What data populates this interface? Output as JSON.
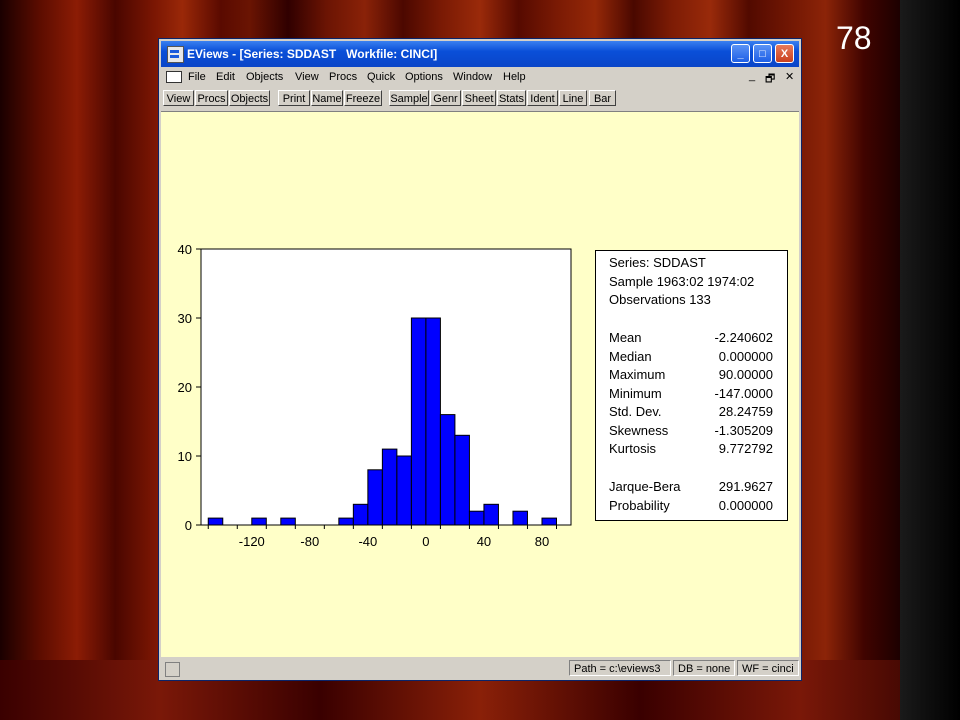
{
  "slide_number": "78",
  "window": {
    "title": "EViews - [Series: SDDAST   Workfile: CINCI]",
    "controls": {
      "minimize": "_",
      "maximize": "□",
      "close": "X"
    }
  },
  "menu": {
    "items": [
      "File",
      "Edit",
      "Objects",
      "View",
      "Procs",
      "Quick",
      "Options",
      "Window",
      "Help"
    ],
    "mdi_controls": [
      "_",
      "🗗",
      "✕"
    ]
  },
  "toolbar": {
    "buttons": [
      "View",
      "Procs",
      "Objects",
      "Print",
      "Name",
      "Freeze",
      "Sample",
      "Genr",
      "Sheet",
      "Stats",
      "Ident",
      "Line",
      "Bar"
    ]
  },
  "chart_data": {
    "type": "bar",
    "title": "",
    "xlabel": "",
    "ylabel": "",
    "bin_width": 10,
    "bins": [
      {
        "x": -145,
        "count": 1
      },
      {
        "x": -135,
        "count": 0
      },
      {
        "x": -125,
        "count": 0
      },
      {
        "x": -115,
        "count": 1
      },
      {
        "x": -105,
        "count": 0
      },
      {
        "x": -95,
        "count": 1
      },
      {
        "x": -85,
        "count": 0
      },
      {
        "x": -75,
        "count": 0
      },
      {
        "x": -65,
        "count": 0
      },
      {
        "x": -55,
        "count": 1
      },
      {
        "x": -45,
        "count": 3
      },
      {
        "x": -35,
        "count": 8
      },
      {
        "x": -25,
        "count": 11
      },
      {
        "x": -15,
        "count": 10
      },
      {
        "x": -5,
        "count": 30
      },
      {
        "x": 5,
        "count": 30
      },
      {
        "x": 15,
        "count": 16
      },
      {
        "x": 25,
        "count": 13
      },
      {
        "x": 35,
        "count": 2
      },
      {
        "x": 45,
        "count": 3
      },
      {
        "x": 55,
        "count": 0
      },
      {
        "x": 65,
        "count": 2
      },
      {
        "x": 75,
        "count": 0
      },
      {
        "x": 85,
        "count": 1
      }
    ],
    "xlim": [
      -155,
      100
    ],
    "ylim": [
      0,
      40
    ],
    "x_ticks": [
      "-120",
      "-80",
      "-40",
      "0",
      "40",
      "80"
    ],
    "y_ticks": [
      "0",
      "10",
      "20",
      "30",
      "40"
    ],
    "bar_color": "#0000ff",
    "grid": false
  },
  "stats": {
    "series_line": "Series: SDDAST",
    "sample_line": "Sample 1963:02 1974:02",
    "obs_line": "Observations 133",
    "rows": [
      {
        "label": "Mean",
        "value": "-2.240602"
      },
      {
        "label": "Median",
        "value": "0.000000"
      },
      {
        "label": "Maximum",
        "value": "90.00000"
      },
      {
        "label": "Minimum",
        "value": "-147.0000"
      },
      {
        "label": "Std. Dev.",
        "value": "28.24759"
      },
      {
        "label": "Skewness",
        "value": "-1.305209"
      },
      {
        "label": "Kurtosis",
        "value": "9.772792"
      }
    ],
    "jb_rows": [
      {
        "label": "Jarque-Bera",
        "value": "291.9627"
      },
      {
        "label": "Probability",
        "value": "0.000000"
      }
    ]
  },
  "statusbar": {
    "path": "Path = c:\\eviews3",
    "db": "DB = none",
    "wf": "WF = cinci"
  }
}
